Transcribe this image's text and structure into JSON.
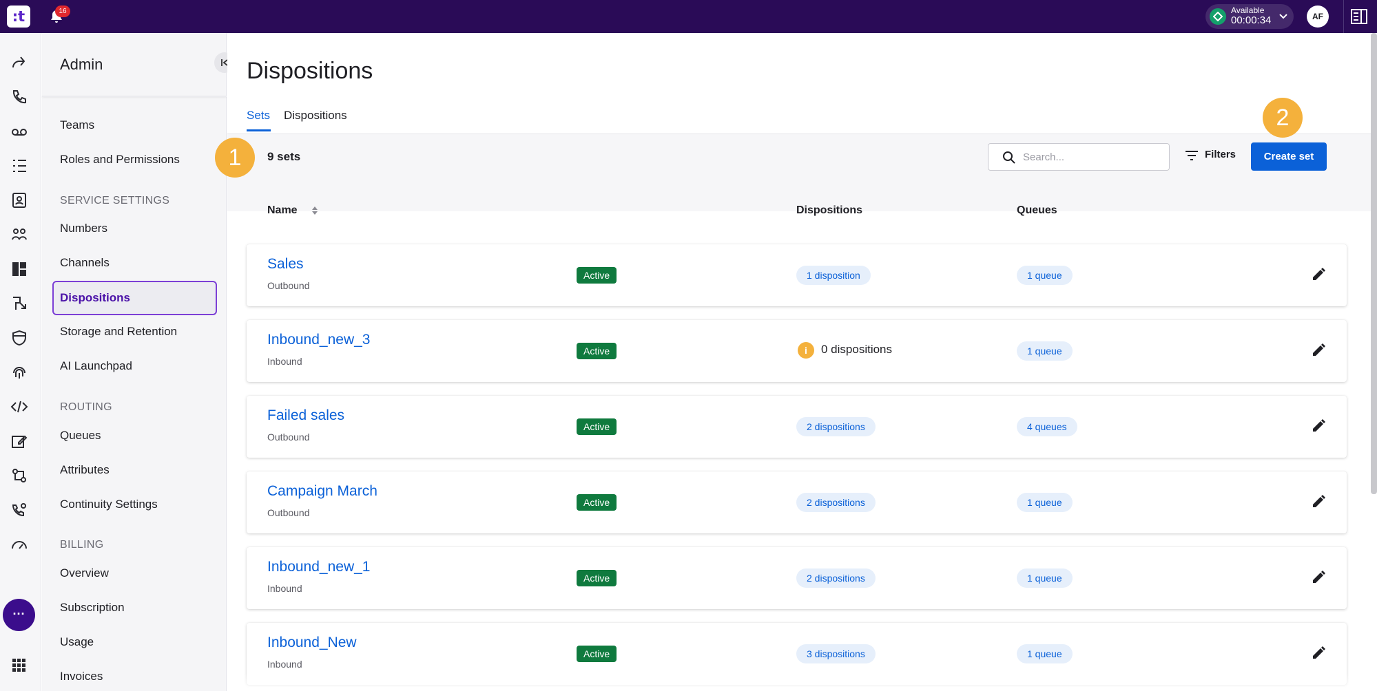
{
  "topbar": {
    "logo": ":t",
    "notifications_count": "16",
    "status": {
      "label": "Available",
      "time": "00:00:34",
      "color": "#14a06b"
    },
    "avatar_initials": "AF"
  },
  "rail": {
    "icons": [
      "insights-icon",
      "calls-icon",
      "voicemail-icon",
      "list-icon",
      "contacts-icon",
      "users-icon",
      "dashboard-icon",
      "routing-icon",
      "shield-icon",
      "fingerprint-icon",
      "code-icon",
      "edit-icon",
      "flows-icon",
      "phone-settings-icon",
      "speed-icon"
    ],
    "more_label": "···"
  },
  "sidebar": {
    "title": "Admin",
    "items": {
      "teams": "Teams",
      "roles": "Roles and Permissions",
      "service_section": "SERVICE SETTINGS",
      "numbers": "Numbers",
      "channels": "Channels",
      "dispositions": "Dispositions",
      "storage": "Storage and Retention",
      "ai": "AI Launchpad",
      "routing_section": "ROUTING",
      "queues": "Queues",
      "attributes": "Attributes",
      "continuity": "Continuity Settings",
      "billing_section": "BILLING",
      "overview": "Overview",
      "subscription": "Subscription",
      "usage": "Usage",
      "invoices": "Invoices"
    }
  },
  "main": {
    "title": "Dispositions",
    "tabs": {
      "sets": "Sets",
      "dispositions": "Dispositions"
    },
    "count_label": "9 sets",
    "markers": {
      "one": "1",
      "two": "2"
    },
    "search_placeholder": "Search...",
    "filters_label": "Filters",
    "create_label": "Create set",
    "columns": {
      "name": "Name",
      "dispositions": "Dispositions",
      "queues": "Queues"
    },
    "rows": [
      {
        "name": "Sales",
        "type": "Outbound",
        "status": "Active",
        "dispositions": "1 disposition",
        "queues": "1 queue"
      },
      {
        "name": "Inbound_new_3",
        "type": "Inbound",
        "status": "Active",
        "dispositions": "0 dispositions",
        "queues": "1 queue"
      },
      {
        "name": "Failed sales",
        "type": "Outbound",
        "status": "Active",
        "dispositions": "2 dispositions",
        "queues": "4 queues"
      },
      {
        "name": "Campaign March",
        "type": "Outbound",
        "status": "Active",
        "dispositions": "2 dispositions",
        "queues": "1 queue"
      },
      {
        "name": "Inbound_new_1",
        "type": "Inbound",
        "status": "Active",
        "dispositions": "2 dispositions",
        "queues": "1 queue"
      },
      {
        "name": "Inbound_New",
        "type": "Inbound",
        "status": "Active",
        "dispositions": "3 dispositions",
        "queues": "1 queue"
      }
    ]
  },
  "colors": {
    "topbar": "#2a0b57",
    "accent": "#0b61d8",
    "active_badge": "#0f7a3e",
    "marker": "#f4b13c",
    "nav_active": "#7c3fd6"
  }
}
